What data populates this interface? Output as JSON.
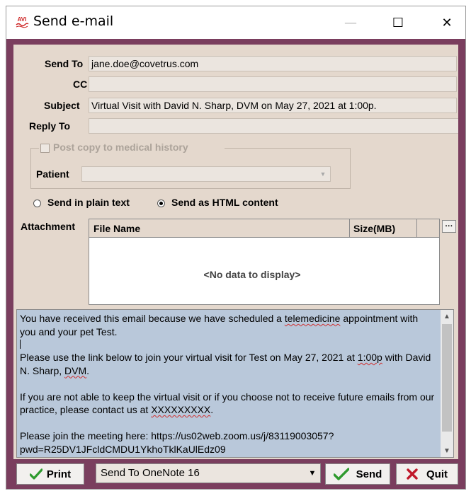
{
  "window": {
    "title": "Send e-mail",
    "app_icon_text": "AVI",
    "controls": {
      "minimize": "—",
      "maximize": "☐",
      "close": "✕"
    }
  },
  "form": {
    "send_to_label": "Send To",
    "send_to_value": "jane.doe@covetrus.com",
    "cc_label": "CC",
    "cc_value": "",
    "subject_label": "Subject",
    "subject_value": "Virtual Visit with David N. Sharp, DVM on May 27, 2021 at 1:00p.",
    "reply_to_label": "Reply To",
    "reply_to_value": ""
  },
  "medical_history": {
    "checkbox_label": "Post copy to medical history",
    "checked": false,
    "patient_label": "Patient",
    "patient_value": ""
  },
  "format": {
    "plain_label": "Send in plain text",
    "html_label": "Send as HTML content",
    "selected": "html"
  },
  "attachments": {
    "label": "Attachment",
    "columns": [
      "File Name",
      "Size(MB)"
    ],
    "rows": [],
    "empty_text": "<No data to display>",
    "more_button": "···"
  },
  "body": {
    "p1": "You have received this email because we have scheduled a ",
    "p1_squig": "telemedicine",
    "p1_end": " appointment with you and your pet Test.",
    "p2_start": "Please use the link below to join your virtual visit for Test on May 27, 2021 at ",
    "p2_squig1": "1:00p",
    "p2_mid": " with David N. Sharp, ",
    "p2_squig2": "DVM",
    "p2_end": ".",
    "p3_start": "If you are not able to keep the virtual visit or if you choose not to receive future emails from our practice, please contact us at ",
    "p3_squig": "XXXXXXXXX",
    "p3_end": ".",
    "p4": "Please join the meeting here: https://us02web.zoom.us/j/83119003057?",
    "p5": "pwd=R25DV1JFcldCMDU1YkhoTklKaUlEdz09"
  },
  "footer": {
    "print_label": "Print",
    "printer_value": "Send To OneNote 16",
    "send_label": "Send",
    "quit_label": "Quit"
  },
  "colors": {
    "frame": "#7a3e5e",
    "client": "#e4d8cd",
    "body_bg": "#b9c8da",
    "check_green": "#2e9a2e",
    "quit_red": "#c0182a"
  }
}
